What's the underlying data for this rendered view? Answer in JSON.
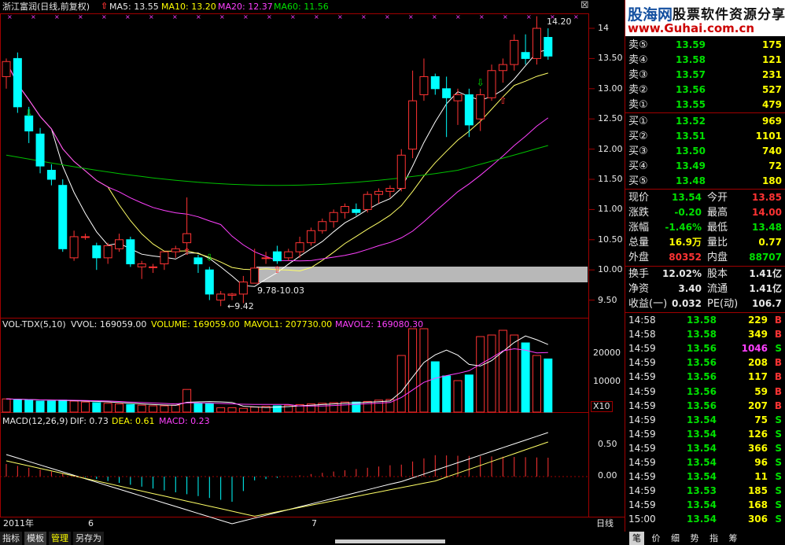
{
  "chart_header": {
    "stock": "浙江富润(日线,前复权)",
    "ma5": "MA5: 13.55",
    "ma10": "MA10: 13.20",
    "ma20": "MA20: 12.37",
    "ma60": "MA60: 11.56",
    "price_high_label": "14.20",
    "range_label": "9.78-10.03",
    "low_label": "9.42"
  },
  "watermark": {
    "brand": "股海网",
    "slogan": "股票软件资源分享",
    "url": "www.Guhai.com.cn"
  },
  "colors": {
    "up": "#ff3333",
    "down": "#00ffff",
    "ma5": "#ffffff",
    "ma10": "#ffff66",
    "ma20": "#ff40ff",
    "ma60": "#00c000",
    "grid": "#a00000"
  },
  "price_axis": [
    "14",
    "13.50",
    "13.00",
    "12.50",
    "12.00",
    "11.50",
    "11.00",
    "10.50",
    "10.00",
    "9.50"
  ],
  "volume_header": {
    "name": "VOL-TDX(5,10)",
    "vvol": "VVOL: 169059.00",
    "volume": "VOLUME: 169059.00",
    "mavol1": "MAVOL1: 207730.00",
    "mavol2": "MAVOL2: 169080.30"
  },
  "volume_axis": [
    "20000",
    "10000",
    "X10"
  ],
  "macd_header": {
    "name": "MACD(12,26,9)",
    "dif": "DIF: 0.73",
    "dea": "DEA: 0.61",
    "macd": "MACD: 0.23"
  },
  "macd_axis": [
    "0.50",
    "0.00"
  ],
  "time_axis": {
    "year": "2011年",
    "m6": "6",
    "m7": "7"
  },
  "period_label": "日线",
  "bottom_tabs": [
    "指标",
    "模板",
    "管理",
    "另存为"
  ],
  "right_tabs": [
    "笔",
    "价",
    "细",
    "势",
    "指",
    "筹"
  ],
  "order_book": {
    "asks": [
      {
        "label": "卖⑤",
        "price": "13.59",
        "vol": "175"
      },
      {
        "label": "卖④",
        "price": "13.58",
        "vol": "121"
      },
      {
        "label": "卖③",
        "price": "13.57",
        "vol": "231"
      },
      {
        "label": "卖②",
        "price": "13.56",
        "vol": "527"
      },
      {
        "label": "卖①",
        "price": "13.55",
        "vol": "479"
      }
    ],
    "bids": [
      {
        "label": "买①",
        "price": "13.52",
        "vol": "969"
      },
      {
        "label": "买②",
        "price": "13.51",
        "vol": "1101"
      },
      {
        "label": "买③",
        "price": "13.50",
        "vol": "740"
      },
      {
        "label": "买④",
        "price": "13.49",
        "vol": "72"
      },
      {
        "label": "买⑤",
        "price": "13.48",
        "vol": "180"
      }
    ]
  },
  "quote": {
    "xianjia": {
      "label": "现价",
      "value": "13.54"
    },
    "jinkai": {
      "label": "今开",
      "value": "13.85"
    },
    "zhangdie": {
      "label": "涨跌",
      "value": "-0.20"
    },
    "zuigao": {
      "label": "最高",
      "value": "14.00"
    },
    "zhangfu": {
      "label": "涨幅",
      "value": "-1.46%"
    },
    "zuidi": {
      "label": "最低",
      "value": "13.48"
    },
    "zongliang": {
      "label": "总量",
      "value": "16.9万"
    },
    "liangbi": {
      "label": "量比",
      "value": "0.77"
    },
    "waipan": {
      "label": "外盘",
      "value": "80352"
    },
    "neipan": {
      "label": "内盘",
      "value": "88707"
    },
    "huanshou": {
      "label": "换手",
      "value": "12.02%"
    },
    "guben": {
      "label": "股本",
      "value": "1.41亿"
    },
    "jingzi": {
      "label": "净资",
      "value": "3.40"
    },
    "liutong": {
      "label": "流通",
      "value": "1.41亿"
    },
    "shouyi": {
      "label": "收益(一)",
      "value": "0.032"
    },
    "pe": {
      "label": "PE(动)",
      "value": "106.7"
    }
  },
  "ticks": [
    {
      "time": "14:58",
      "price": "13.58",
      "vol": "229",
      "side": "B"
    },
    {
      "time": "14:58",
      "price": "13.58",
      "vol": "349",
      "side": "B"
    },
    {
      "time": "14:59",
      "price": "13.56",
      "vol": "1046",
      "side": "S"
    },
    {
      "time": "14:59",
      "price": "13.56",
      "vol": "208",
      "side": "B"
    },
    {
      "time": "14:59",
      "price": "13.56",
      "vol": "117",
      "side": "B"
    },
    {
      "time": "14:59",
      "price": "13.56",
      "vol": "59",
      "side": "B"
    },
    {
      "time": "14:59",
      "price": "13.56",
      "vol": "207",
      "side": "B"
    },
    {
      "time": "14:59",
      "price": "13.54",
      "vol": "75",
      "side": "S"
    },
    {
      "time": "14:59",
      "price": "13.54",
      "vol": "126",
      "side": "S"
    },
    {
      "time": "14:59",
      "price": "13.54",
      "vol": "366",
      "side": "S"
    },
    {
      "time": "14:59",
      "price": "13.54",
      "vol": "96",
      "side": "S"
    },
    {
      "time": "14:59",
      "price": "13.54",
      "vol": "11",
      "side": "S"
    },
    {
      "time": "14:59",
      "price": "13.53",
      "vol": "185",
      "side": "S"
    },
    {
      "time": "14:59",
      "price": "13.54",
      "vol": "168",
      "side": "S"
    },
    {
      "time": "15:00",
      "price": "13.54",
      "vol": "306",
      "side": "S"
    }
  ],
  "chart_data": {
    "type": "candlestick",
    "candles": [
      [
        13.2,
        13.5,
        13.0,
        13.45
      ],
      [
        13.5,
        13.6,
        12.6,
        12.7
      ],
      [
        12.55,
        12.7,
        12.1,
        12.3
      ],
      [
        12.25,
        12.35,
        11.6,
        11.72
      ],
      [
        11.65,
        11.75,
        11.4,
        11.5
      ],
      [
        11.4,
        11.5,
        10.3,
        10.35
      ],
      [
        10.2,
        10.65,
        10.15,
        10.55
      ],
      [
        10.55,
        10.6,
        10.5,
        10.55
      ],
      [
        10.4,
        10.45,
        10.0,
        10.2
      ],
      [
        10.2,
        10.45,
        10.1,
        10.4
      ],
      [
        10.35,
        10.6,
        10.3,
        10.5
      ],
      [
        10.5,
        10.55,
        10.05,
        10.1
      ],
      [
        10.05,
        10.15,
        9.85,
        10.1
      ],
      [
        10.05,
        10.1,
        9.95,
        10.05
      ],
      [
        10.1,
        10.3,
        10.0,
        10.3
      ],
      [
        10.3,
        10.4,
        10.2,
        10.35
      ],
      [
        10.45,
        11.2,
        10.3,
        10.6
      ],
      [
        10.2,
        10.25,
        9.95,
        10.1
      ],
      [
        10.0,
        10.05,
        9.5,
        9.6
      ],
      [
        9.5,
        9.65,
        9.4,
        9.6
      ],
      [
        9.58,
        9.62,
        9.5,
        9.6
      ],
      [
        9.6,
        9.9,
        9.45,
        9.8
      ],
      [
        9.78,
        10.35,
        9.78,
        10.03
      ],
      [
        10.2,
        10.3,
        10.1,
        10.2
      ],
      [
        10.3,
        10.4,
        10.1,
        10.15
      ],
      [
        10.2,
        10.35,
        10.15,
        10.3
      ],
      [
        10.3,
        10.55,
        10.2,
        10.45
      ],
      [
        10.45,
        10.7,
        10.4,
        10.65
      ],
      [
        10.65,
        10.85,
        10.6,
        10.8
      ],
      [
        10.8,
        11.0,
        10.7,
        10.95
      ],
      [
        10.95,
        11.1,
        10.85,
        11.05
      ],
      [
        11.0,
        11.1,
        10.9,
        10.95
      ],
      [
        11.0,
        11.3,
        10.95,
        11.25
      ],
      [
        11.25,
        11.35,
        11.1,
        11.3
      ],
      [
        11.3,
        11.4,
        11.2,
        11.35
      ],
      [
        11.35,
        12.0,
        11.3,
        11.9
      ],
      [
        12.0,
        13.3,
        11.85,
        12.8
      ],
      [
        12.9,
        13.5,
        12.8,
        13.2
      ],
      [
        13.2,
        13.25,
        12.9,
        13.0
      ],
      [
        13.0,
        13.2,
        12.2,
        12.85
      ],
      [
        12.8,
        13.0,
        12.4,
        12.9
      ],
      [
        12.9,
        13.0,
        12.2,
        12.4
      ],
      [
        12.5,
        13.0,
        12.3,
        12.9
      ],
      [
        12.85,
        13.4,
        12.8,
        13.3
      ],
      [
        13.3,
        13.5,
        13.1,
        13.4
      ],
      [
        13.4,
        13.9,
        13.3,
        13.8
      ],
      [
        13.6,
        13.9,
        13.4,
        13.5
      ],
      [
        13.5,
        14.2,
        13.4,
        14.0
      ],
      [
        13.85,
        14.0,
        13.48,
        13.54
      ]
    ]
  }
}
